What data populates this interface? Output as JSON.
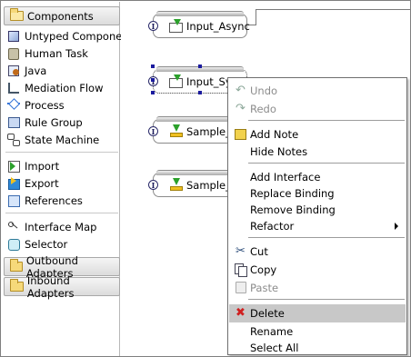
{
  "palette": {
    "components_drawer": "Components",
    "components": [
      {
        "label": "Untyped Component",
        "icon": "untyped-component-icon"
      },
      {
        "label": "Human Task",
        "icon": "human-task-icon"
      },
      {
        "label": "Java",
        "icon": "java-icon"
      },
      {
        "label": "Mediation Flow",
        "icon": "mediation-flow-icon"
      },
      {
        "label": "Process",
        "icon": "process-icon"
      },
      {
        "label": "Rule Group",
        "icon": "rule-group-icon"
      },
      {
        "label": "State Machine",
        "icon": "state-machine-icon"
      }
    ],
    "io": [
      {
        "label": "Import",
        "icon": "import-icon"
      },
      {
        "label": "Export",
        "icon": "export-icon"
      },
      {
        "label": "References",
        "icon": "references-icon"
      }
    ],
    "maps": [
      {
        "label": "Interface Map",
        "icon": "interface-map-icon"
      },
      {
        "label": "Selector",
        "icon": "selector-icon"
      }
    ],
    "outbound_drawer": "Outbound Adapters",
    "inbound_drawer": "Inbound Adapters"
  },
  "canvas": {
    "nodes": [
      {
        "label": "Input_Async",
        "icon": "export-envelope-icon",
        "interface_marker": "I"
      },
      {
        "label": "Input_Sync",
        "icon": "export-envelope-icon",
        "interface_marker": "I",
        "selected": true
      },
      {
        "label": "Sample_EM",
        "icon": "export-icon",
        "interface_marker": "I"
      },
      {
        "label": "Sample_EM",
        "icon": "export-icon",
        "interface_marker": "I"
      }
    ]
  },
  "context_menu": {
    "items": [
      {
        "label": "Undo",
        "enabled": false,
        "icon": "undo-icon"
      },
      {
        "label": "Redo",
        "enabled": false,
        "icon": "redo-icon"
      },
      {
        "label": "Add Note",
        "enabled": true,
        "icon": "note-icon"
      },
      {
        "label": "Hide Notes",
        "enabled": true
      },
      {
        "label": "Add Interface",
        "enabled": true
      },
      {
        "label": "Replace Binding",
        "enabled": true
      },
      {
        "label": "Remove Binding",
        "enabled": true
      },
      {
        "label": "Refactor",
        "enabled": true,
        "submenu": true
      },
      {
        "label": "Cut",
        "enabled": true,
        "icon": "cut-icon"
      },
      {
        "label": "Copy",
        "enabled": true,
        "icon": "copy-icon"
      },
      {
        "label": "Paste",
        "enabled": false,
        "icon": "paste-icon"
      },
      {
        "label": "Delete",
        "enabled": true,
        "icon": "delete-icon",
        "highlighted": true
      },
      {
        "label": "Rename",
        "enabled": true
      },
      {
        "label": "Select All",
        "enabled": true
      }
    ]
  },
  "colors": {
    "menu_highlight": "#c8c8c8",
    "selection_handle": "#1b1b9e",
    "delete_icon": "#d02020"
  }
}
